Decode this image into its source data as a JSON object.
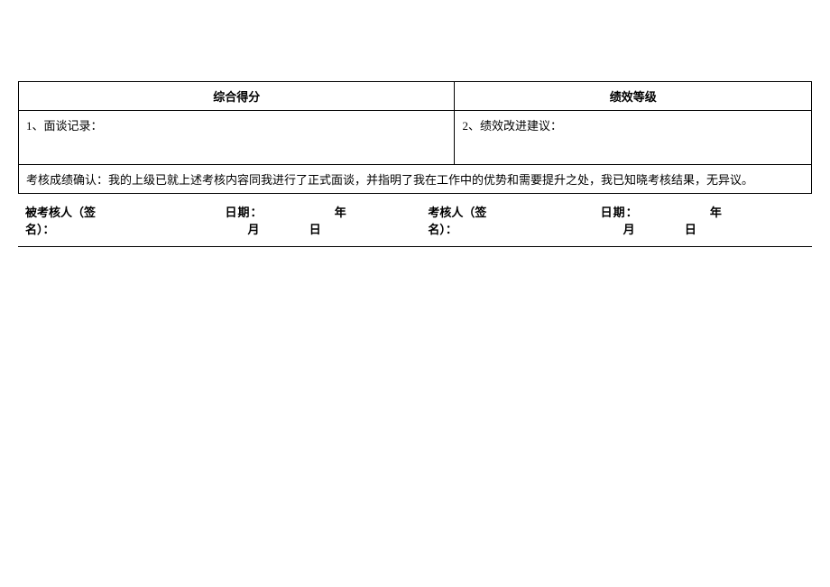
{
  "header": {
    "score_label": "综合得分",
    "grade_label": "绩效等级"
  },
  "records": {
    "interview": "1、面谈记录：",
    "improvement": "2、绩效改进建议："
  },
  "confirmation": "考核成绩确认：我的上级已就上述考核内容同我进行了正式面谈，并指明了我在工作中的优势和需要提升之处，我已知晓考核结果，无异议。",
  "signatures": {
    "assessee_label": "被考核人（签名）：",
    "assessor_label": "考核人（签名）：",
    "date_label": "日期：",
    "year": "年",
    "month": "月",
    "day": "日"
  }
}
